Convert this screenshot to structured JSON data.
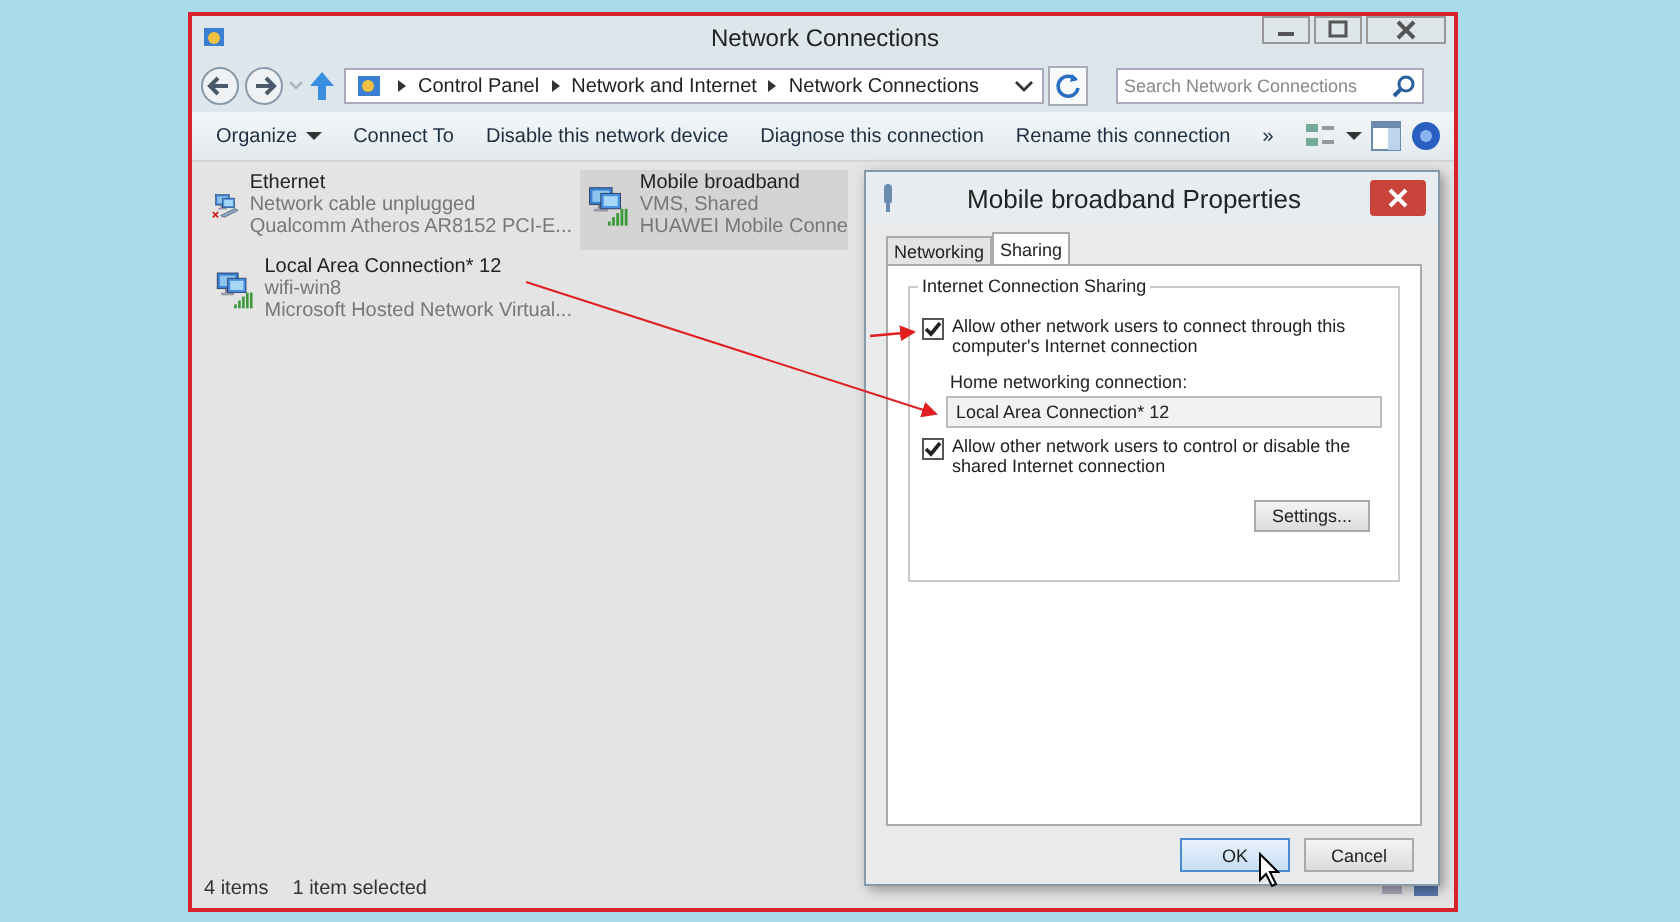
{
  "window": {
    "title": "Network Connections"
  },
  "address": {
    "crumbs": [
      "Control Panel",
      "Network and Internet",
      "Network Connections"
    ],
    "search_placeholder": "Search Network Connections"
  },
  "toolbar": [
    {
      "label": "Organize",
      "kind": "menu"
    },
    {
      "label": "Connect To",
      "kind": "plain"
    },
    {
      "label": "Disable this network device",
      "kind": "plain"
    },
    {
      "label": "Diagnose this connection",
      "kind": "plain"
    },
    {
      "label": "Rename this connection",
      "kind": "plain"
    },
    {
      "label": "»",
      "kind": "plain"
    }
  ],
  "connections": [
    {
      "name": "Ethernet",
      "status": "Network cable unplugged",
      "device": "Qualcomm Atheros AR8152 PCI-E...",
      "connected": false,
      "selected": false
    },
    {
      "name": "Mobile broadband",
      "status": "VMS, Shared",
      "device": "HUAWEI Mobile Conne",
      "connected": true,
      "selected": true
    },
    {
      "name": "Local Area Connection* 12",
      "status": "wifi-win8",
      "device": "Microsoft Hosted Network Virtual...",
      "connected": true,
      "selected": false
    }
  ],
  "status_bar": [
    "4 items",
    "1 item selected"
  ],
  "dialog": {
    "title": "Mobile broadband Properties",
    "tabs": [
      {
        "label": "Networking",
        "selected": false
      },
      {
        "label": "Sharing",
        "selected": true
      }
    ],
    "group_title": "Internet Connection Sharing",
    "allow_connect": {
      "label": "Allow other network users to connect through this computer's Internet connection",
      "checked": true
    },
    "home_label": "Home networking connection:",
    "home_value": "Local Area Connection* 12",
    "allow_control": {
      "label": "Allow other network users to control or disable the shared Internet connection",
      "checked": true
    },
    "settings_button": "Settings...",
    "buttons": [
      {
        "label": "OK",
        "focused": true
      },
      {
        "label": "Cancel",
        "focused": false
      }
    ]
  }
}
